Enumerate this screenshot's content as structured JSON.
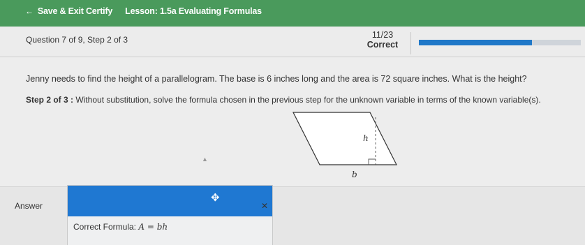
{
  "topbar": {
    "save_exit": "Save & Exit Certify",
    "lesson": "Lesson: 1.5a Evaluating Formulas"
  },
  "header": {
    "question_step": "Question 7 of 9, Step 2 of 3",
    "score_fraction": "11/23",
    "score_label": "Correct",
    "progress_fraction": 0.7
  },
  "problem": {
    "text": "Jenny needs to find the height of a parallelogram. The base is 6 inches long and the area is 72 square inches. What is the height?",
    "step_label": "Step 2 of 3 :",
    "step_text": " Without substitution, solve the formula chosen in the previous step for the unknown variable in terms of the known variable(s)."
  },
  "figure": {
    "height_label": "h",
    "base_label": "b"
  },
  "answer": {
    "label": "Answer",
    "formula_prefix": "Correct Formula: ",
    "formula": "A = bh"
  },
  "colors": {
    "topbar": "#4a9a5c",
    "accent": "#1f78d2"
  }
}
